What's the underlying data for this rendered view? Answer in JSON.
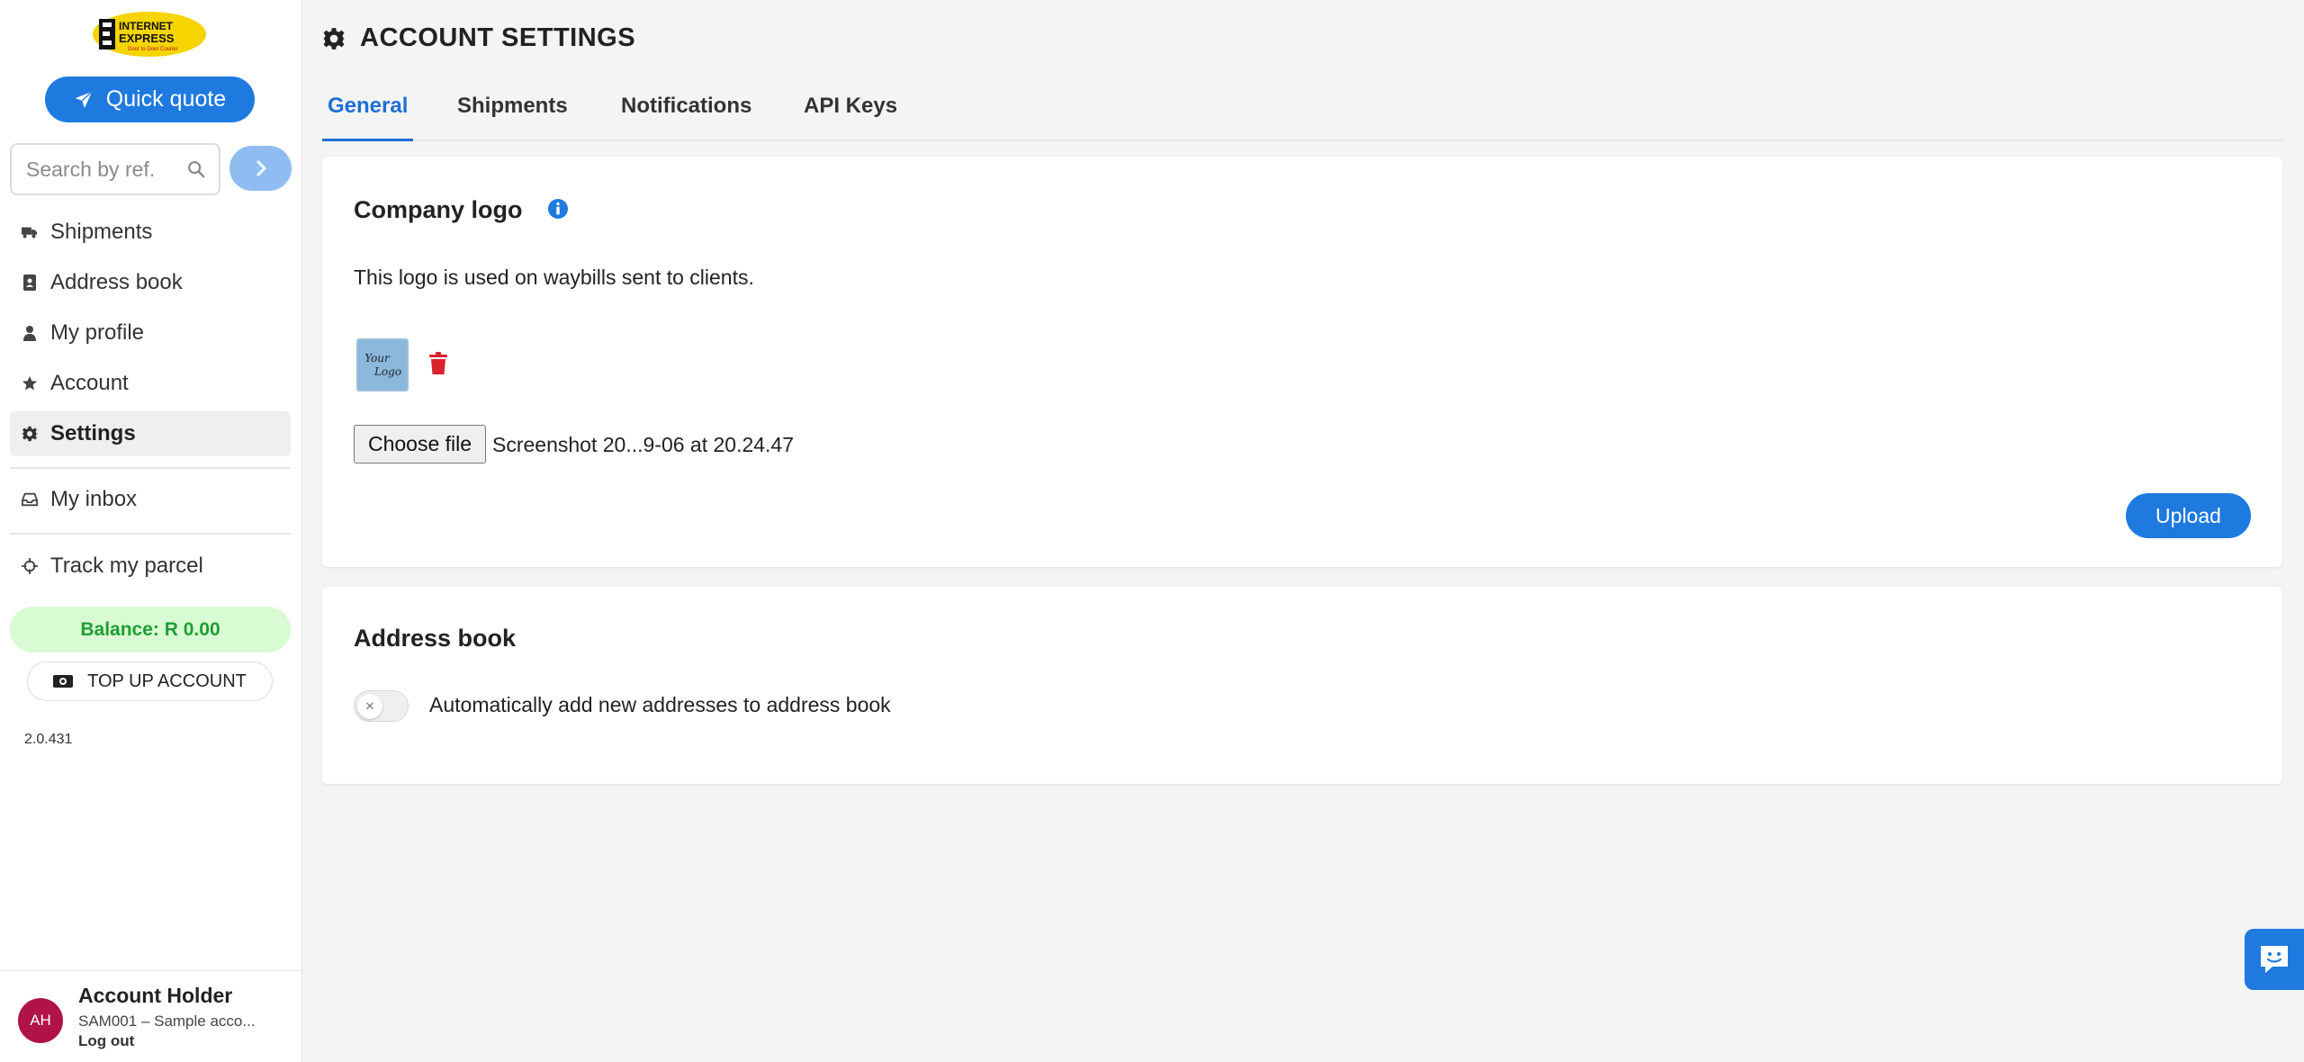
{
  "brand": {
    "logo_line1": "INTERNET",
    "logo_line2": "EXPRESS",
    "logo_tagline": "Door to Door Courier",
    "accent": "#1f7ae0"
  },
  "sidebar": {
    "quote_button": "Quick quote",
    "search_placeholder": "Search by ref.",
    "nav": [
      {
        "label": "Shipments",
        "icon": "truck-icon"
      },
      {
        "label": "Address book",
        "icon": "address-book-icon"
      },
      {
        "label": "My profile",
        "icon": "user-icon"
      },
      {
        "label": "Account",
        "icon": "star-icon"
      },
      {
        "label": "Settings",
        "icon": "gear-icon",
        "active": true
      },
      {
        "label": "My inbox",
        "icon": "inbox-icon"
      },
      {
        "label": "Track my parcel",
        "icon": "crosshair-icon"
      }
    ],
    "balance": "Balance: R 0.00",
    "topup_button": "TOP UP ACCOUNT",
    "version": "2.0.431",
    "user": {
      "initials": "AH",
      "name": "Account Holder",
      "account": "SAM001 – Sample acco...",
      "logout": "Log out"
    }
  },
  "main": {
    "title": "ACCOUNT SETTINGS",
    "tabs": [
      {
        "label": "General",
        "active": true
      },
      {
        "label": "Shipments"
      },
      {
        "label": "Notifications"
      },
      {
        "label": "API Keys"
      }
    ],
    "logo_card": {
      "title": "Company logo",
      "description": "This logo is used on waybills sent to clients.",
      "thumb_line1": "Your",
      "thumb_line2": "Logo",
      "file_button": "Choose file",
      "file_name": "Screenshot 20...9-06 at 20.24.47",
      "upload_button": "Upload"
    },
    "address_card": {
      "title": "Address book",
      "toggle_label": "Automatically add new addresses to address book",
      "toggle_on": false
    }
  }
}
